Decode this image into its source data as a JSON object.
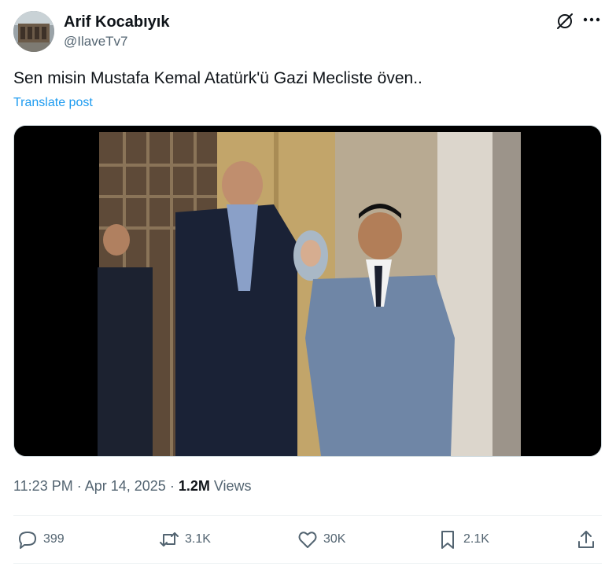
{
  "author": {
    "display_name": "Arif Kocabıyık",
    "handle": "@IlaveTv7"
  },
  "icons": {
    "grok": "grok-icon",
    "more": "more-horizontal-icon",
    "reply": "reply-icon",
    "repost": "repost-icon",
    "like": "heart-icon",
    "bookmark": "bookmark-icon",
    "share": "share-icon"
  },
  "post": {
    "text": "Sen misin Mustafa Kemal Atatürk'ü Gazi Mecliste öven..",
    "translate_label": "Translate post"
  },
  "meta": {
    "time": "11:23 PM",
    "separator1": " · ",
    "date": "Apr 14, 2025",
    "separator2": " · ",
    "views_count": "1.2M",
    "views_label": " Views"
  },
  "actions": {
    "replies": "399",
    "reposts": "3.1K",
    "likes": "30K",
    "bookmarks": "2.1K"
  },
  "colors": {
    "accent": "#1d9bf0",
    "text_primary": "#0f1419",
    "text_secondary": "#536471",
    "divider": "#eff3f4"
  }
}
